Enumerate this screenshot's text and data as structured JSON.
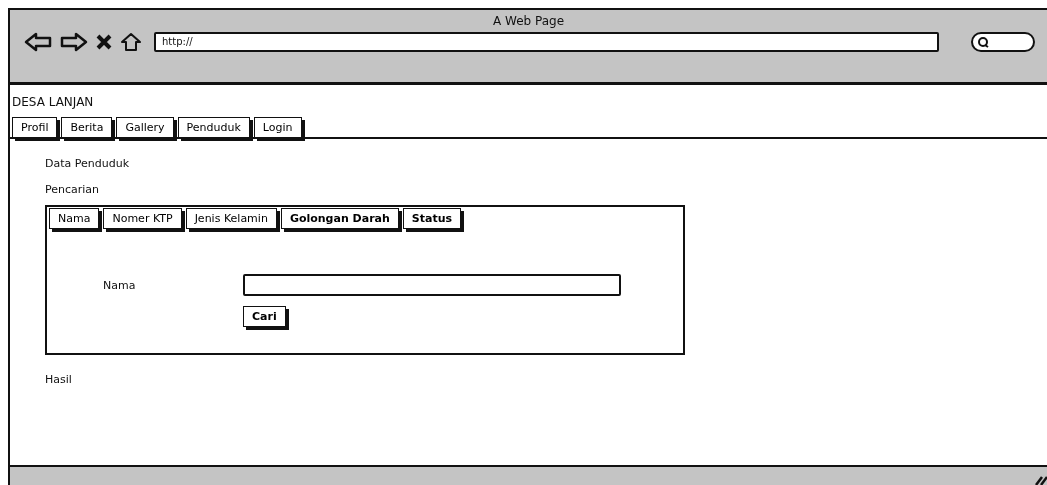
{
  "window": {
    "title": "A Web Page"
  },
  "address_bar": {
    "value": "http://"
  },
  "site_title": "DESA LANJAN",
  "nav_tabs": [
    {
      "label": "Profil"
    },
    {
      "label": "Berita"
    },
    {
      "label": "Gallery"
    },
    {
      "label": "Penduduk"
    },
    {
      "label": "Login"
    }
  ],
  "heading": "Data Penduduk",
  "search_label": "Pencarian",
  "search_tabs": [
    {
      "label": "Nama",
      "bold": false
    },
    {
      "label": "Nomer KTP",
      "bold": false
    },
    {
      "label": "Jenis Kelamin",
      "bold": false
    },
    {
      "label": "Golongan Darah",
      "bold": true
    },
    {
      "label": "Status",
      "bold": true
    }
  ],
  "search_form": {
    "field_label": "Nama",
    "button": "Cari"
  },
  "results_label": "Hasil"
}
